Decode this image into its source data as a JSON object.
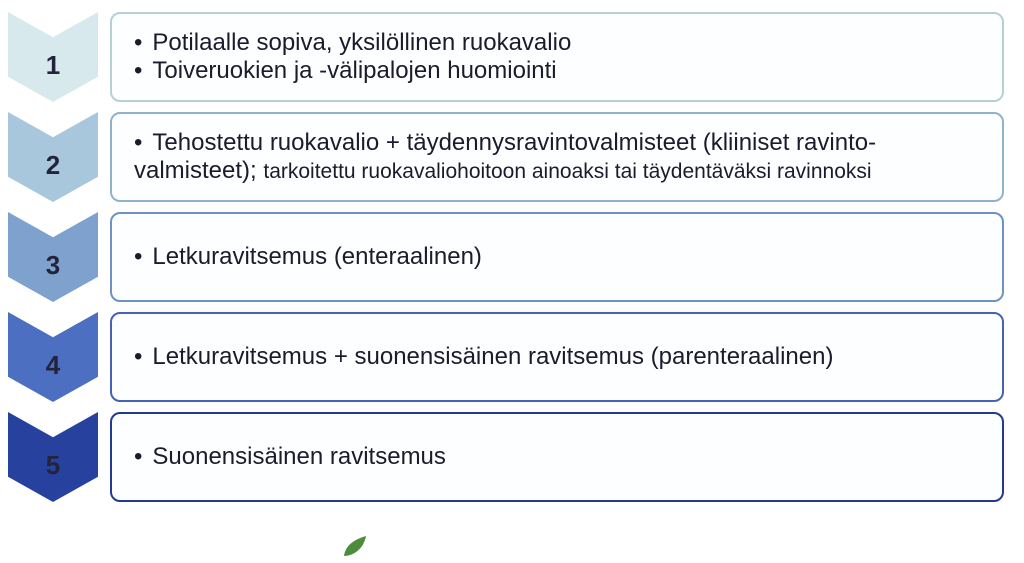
{
  "steps": [
    {
      "number": "1",
      "fill": "#d8e9ed",
      "border": "#b7d0d5",
      "items": [
        {
          "text": "Potilaalle sopiva, yksilöllinen ruokavalio"
        },
        {
          "text": "Toiveruokien ja -välipalojen huomiointi"
        }
      ]
    },
    {
      "number": "2",
      "fill": "#a9c7dc",
      "border": "#8fb2cd",
      "items": [
        {
          "text": "Tehostettu ruokavalio + täydennysravintovalmisteet (kliiniset ravinto-valmisteet); ",
          "secondary": "tarkoitettu ruokavaliohoitoon ainoaksi tai täydentäväksi ravinnoksi"
        }
      ]
    },
    {
      "number": "3",
      "fill": "#7ea2cd",
      "border": "#6d92c3",
      "items": [
        {
          "text": "Letkuravitsemus (enteraalinen)"
        }
      ]
    },
    {
      "number": "4",
      "fill": "#4c6fc1",
      "border": "#4563b2",
      "items": [
        {
          "text": "Letkuravitsemus + suonensisäinen ravitsemus (parenteraalinen)"
        }
      ]
    },
    {
      "number": "5",
      "fill": "#27419f",
      "border": "#233a93",
      "items": [
        {
          "text": "Suonensisäinen ravitsemus"
        }
      ]
    }
  ]
}
